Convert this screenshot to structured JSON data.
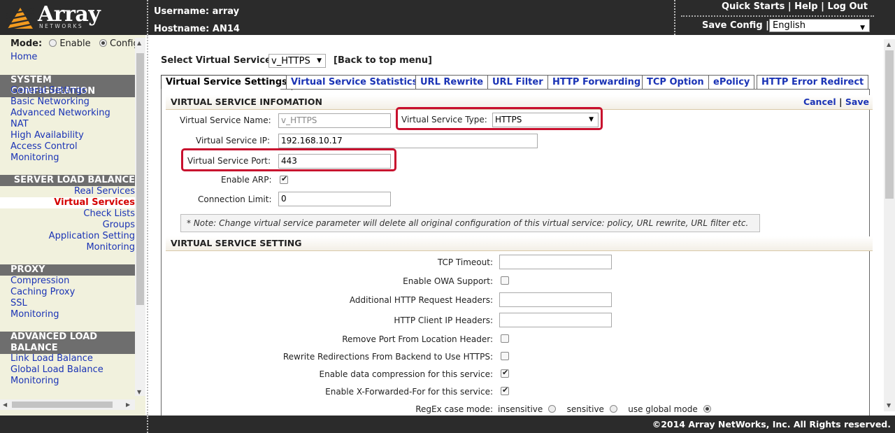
{
  "header": {
    "logo_name": "Array",
    "logo_sub": "NETWORKS",
    "username_label": "Username: array",
    "hostname_label": "Hostname: AN14",
    "links": [
      "Quick Starts",
      "Help",
      "Log Out"
    ],
    "save_config": "Save Config",
    "language": "English"
  },
  "sidebar": {
    "mode_label": "Mode:",
    "mode_enable": "Enable",
    "mode_config": "Config",
    "selected_mode": "Config",
    "home": "Home",
    "sys_head": "SYSTEM CONFIGURATION",
    "sys_items": [
      "General Settings",
      "Basic Networking",
      "Advanced Networking",
      "NAT",
      "High Availability",
      "Access Control",
      "Monitoring"
    ],
    "slb_head": "SERVER LOAD BALANCE",
    "slb_items": [
      "Real Services",
      "Virtual Services",
      "Check Lists",
      "Groups",
      "Application Setting",
      "Monitoring"
    ],
    "slb_selected": "Virtual Services",
    "proxy_head": "PROXY",
    "proxy_items": [
      "Compression",
      "Caching Proxy",
      "SSL",
      "Monitoring"
    ],
    "alb_head_1": "ADVANCED LOAD",
    "alb_head_2": "BALANCE",
    "alb_items": [
      "Link Load Balance",
      "Global Load Balance",
      "Monitoring"
    ]
  },
  "main": {
    "select_label": "Select Virtual Service:",
    "select_value": "v_HTTPS",
    "back_link": "[Back to top menu]",
    "tabs": [
      "Virtual Service Settings",
      "Virtual Service Statistics",
      "URL Rewrite",
      "URL Filter",
      "HTTP Forwarding",
      "TCP Option",
      "ePolicy",
      "HTTP Error Redirect"
    ],
    "active_tab": "Virtual Service Settings",
    "info_section": "VIRTUAL SERVICE INFOMATION",
    "cancel": "Cancel",
    "sep": "|",
    "save": "Save",
    "name_label": "Virtual Service Name:",
    "name_value": "v_HTTPS",
    "type_label": "Virtual Service Type:",
    "type_value": "HTTPS",
    "ip_label": "Virtual Service IP:",
    "ip_value": "192.168.10.17",
    "port_label": "Virtual Service Port:",
    "port_value": "443",
    "arp_label": "Enable ARP:",
    "arp_checked": true,
    "conn_label": "Connection Limit:",
    "conn_value": "0",
    "note": "* Note: Change virtual service parameter will delete all original configuration of this virtual service: policy, URL rewrite, URL filter etc.",
    "setting_section": "VIRTUAL SERVICE SETTING",
    "tcp_timeout_label": "TCP Timeout:",
    "tcp_timeout_value": "",
    "owa_label": "Enable OWA Support:",
    "owa_checked": false,
    "addl_headers_label": "Additional HTTP Request Headers:",
    "addl_headers_value": "",
    "client_ip_label": "HTTP Client IP Headers:",
    "client_ip_value": "",
    "remove_port_label": "Remove Port From Location Header:",
    "remove_port_checked": false,
    "rewrite_label": "Rewrite Redirections From Backend to Use HTTPS:",
    "rewrite_checked": false,
    "compression_label": "Enable data compression for this service:",
    "compression_checked": true,
    "xff_label": "Enable X-Forwarded-For for this service:",
    "xff_checked": true,
    "regex_label": "RegEx case mode:",
    "regex_options": [
      "insensitive",
      "sensitive",
      "use global mode"
    ],
    "regex_selected": "use global mode"
  },
  "footer": {
    "copyright": "©2014 Array NetWorks, Inc. All Rights reserved."
  }
}
